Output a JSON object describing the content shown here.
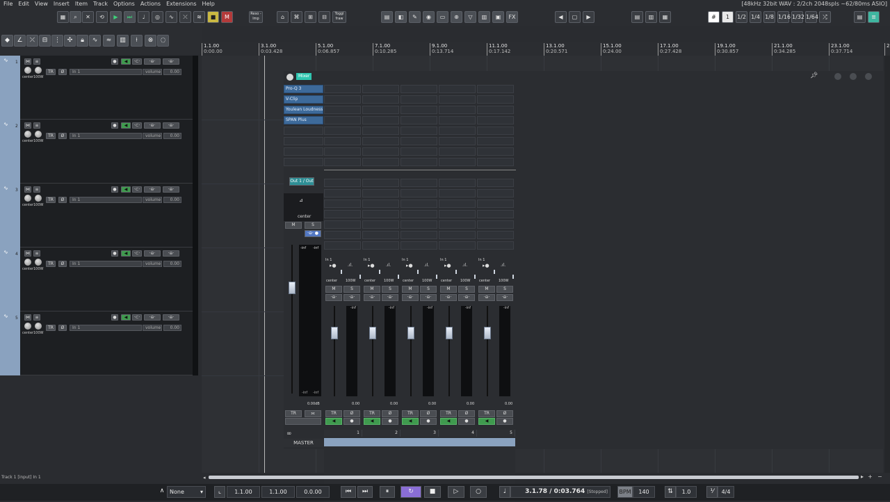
{
  "menu": [
    "File",
    "Edit",
    "View",
    "Insert",
    "Item",
    "Track",
    "Options",
    "Actions",
    "Extensions",
    "Help"
  ],
  "title_info": "[48kHz 32bit WAV : 2/2ch 2048spls ~62/80ms ASIO]",
  "toolbar": {
    "reso_label": "Reso\n-lmp",
    "toggle_label": "Toggl\nfraw",
    "fx_label": "FX",
    "grid_label": "1",
    "divisions": [
      "1/2",
      "1/4",
      "1/8",
      "1/16",
      "1/32",
      "1/64"
    ]
  },
  "ruler": [
    {
      "bar": "1.1.00",
      "time": "0:00.00"
    },
    {
      "bar": "3.1.00",
      "time": "0:03.428"
    },
    {
      "bar": "5.1.00",
      "time": "0:06.857"
    },
    {
      "bar": "7.1.00",
      "time": "0:10.285"
    },
    {
      "bar": "9.1.00",
      "time": "0:13.714"
    },
    {
      "bar": "11.1.00",
      "time": "0:17.142"
    },
    {
      "bar": "13.1.00",
      "time": "0:20.571"
    },
    {
      "bar": "15.1.00",
      "time": "0:24.00"
    },
    {
      "bar": "17.1.00",
      "time": "0:27.428"
    },
    {
      "bar": "19.1.00",
      "time": "0:30.857"
    },
    {
      "bar": "21.1.00",
      "time": "0:34.285"
    },
    {
      "bar": "23.1.00",
      "time": "0:37.714"
    },
    {
      "bar": "2",
      "time": ""
    }
  ],
  "tracks": [
    {
      "num": "1",
      "input": "In 1",
      "vol": "0.00",
      "pan": "center",
      "width": "100W"
    },
    {
      "num": "2",
      "input": "In 1",
      "vol": "0.00",
      "pan": "center",
      "width": "100W"
    },
    {
      "num": "3",
      "input": "In 1",
      "vol": "0.00",
      "pan": "center",
      "width": "100W"
    },
    {
      "num": "4",
      "input": "In 1",
      "vol": "0.00",
      "pan": "center",
      "width": "100W"
    },
    {
      "num": "5",
      "input": "In 1",
      "vol": "0.00",
      "pan": "center",
      "width": "100W"
    }
  ],
  "track_labels": {
    "tr": "TR",
    "phase": "Ø",
    "m": "M",
    "s": "S",
    "vol_placeholder": "volume"
  },
  "mixer": {
    "title": "Mixer",
    "master_fx": [
      "Pro-Q 3",
      "V-Clip",
      "Youlean Loudness M",
      "SPAN Plus"
    ],
    "master_out": "Out 1 / Out",
    "master_pan": "center",
    "master_peak_l": "-inf",
    "master_peak_r": "-inf",
    "master_floor_l": "-inf",
    "master_floor_r": "-inf",
    "master_db": "0.00dB",
    "master_label": "MASTER",
    "strips": [
      {
        "num": "1",
        "input": "In 1",
        "pan": "center",
        "width": "100W",
        "peak": "-inf",
        "db": "0.00"
      },
      {
        "num": "2",
        "input": "In 1",
        "pan": "center",
        "width": "100W",
        "peak": "-inf",
        "db": "0.00"
      },
      {
        "num": "3",
        "input": "In 1",
        "pan": "center",
        "width": "100W",
        "peak": "-inf",
        "db": "0.00"
      },
      {
        "num": "4",
        "input": "In 1",
        "pan": "center",
        "width": "100W",
        "peak": "-inf",
        "db": "0.00"
      },
      {
        "num": "5",
        "input": "In 1",
        "pan": "center",
        "width": "100W",
        "peak": "-inf",
        "db": "0.00"
      }
    ]
  },
  "status_line": "Track 1 [input] In 1",
  "transport": {
    "snap": "None",
    "sel_start": "1.1.00",
    "sel_end": "1.1.00",
    "sel_len": "0.0.00",
    "position": "3.1.78 / 0:03.764",
    "state": "[Stopped]",
    "bpm_label": "BPM",
    "bpm": "140",
    "rate": "1.0",
    "timesig": "4/4"
  },
  "colors": {
    "track": "#8aa2bf",
    "fx_slot": "#3d6a9a",
    "mixer_badge": "#2fc6b0",
    "loop_active": "#8a6ed6",
    "arm_green": "#3f9a4e"
  }
}
